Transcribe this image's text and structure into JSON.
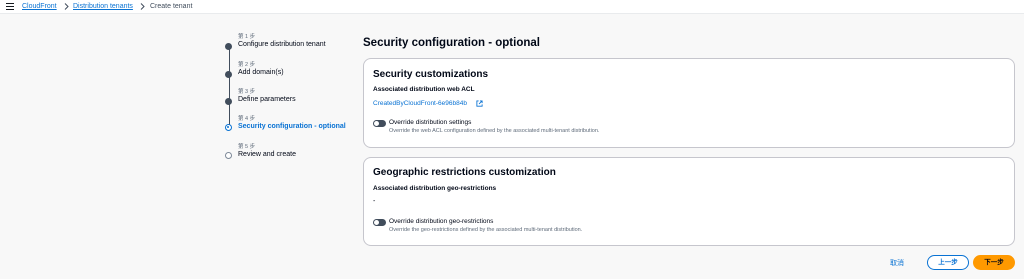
{
  "breadcrumbs": {
    "item1": "CloudFront",
    "item2": "Distribution tenants",
    "current": "Create tenant"
  },
  "steps": [
    {
      "number": "第 1 步",
      "title": "Configure distribution tenant"
    },
    {
      "number": "第 2 步",
      "title": "Add domain(s)"
    },
    {
      "number": "第 3 步",
      "title": "Define parameters"
    },
    {
      "number": "第 4 步",
      "title": "Security configuration - optional"
    },
    {
      "number": "第 5 步",
      "title": "Review and create"
    }
  ],
  "page": {
    "title": "Security configuration - optional"
  },
  "security": {
    "title": "Security customizations",
    "acl_label": "Associated distribution web ACL",
    "acl_value": "CreatedByCloudFront-6e96b84b",
    "toggle_label": "Override distribution settings",
    "toggle_desc": "Override the web ACL configuration defined by the associated multi-tenant distribution."
  },
  "geo": {
    "title": "Geographic restrictions customization",
    "label": "Associated distribution geo-restrictions",
    "value": "-",
    "toggle_label": "Override distribution geo-restrictions",
    "toggle_desc": "Override the geo-restrictions defined by the associated multi-tenant distribution."
  },
  "footer": {
    "cancel": "取消",
    "previous": "上一步",
    "next": "下一步"
  },
  "colors": {
    "accent": "#0972d3",
    "primary_button": "#ff9900"
  }
}
